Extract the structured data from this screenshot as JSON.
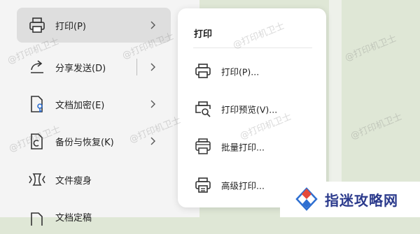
{
  "menu": {
    "items": [
      {
        "label": "打印(P)",
        "icon": "printer-icon",
        "active": true,
        "has_submenu": true
      },
      {
        "label": "分享发送(D)",
        "icon": "share-icon",
        "active": false,
        "has_submenu": true
      },
      {
        "label": "文档加密(E)",
        "icon": "document-key-icon",
        "active": false,
        "has_submenu": true
      },
      {
        "label": "备份与恢复(K)",
        "icon": "backup-icon",
        "active": false,
        "has_submenu": true
      },
      {
        "label": "文件瘦身",
        "icon": "compress-icon",
        "active": false,
        "has_submenu": false
      },
      {
        "label": "文档定稿",
        "icon": "document-final-icon",
        "active": false,
        "has_submenu": false
      }
    ]
  },
  "submenu": {
    "title": "打印",
    "items": [
      {
        "label": "打印(P)...",
        "icon": "printer-icon"
      },
      {
        "label": "打印预览(V)...",
        "icon": "print-preview-icon"
      },
      {
        "label": "批量打印...",
        "icon": "batch-print-icon"
      },
      {
        "label": "高级打印...",
        "icon": "advanced-print-icon"
      }
    ]
  },
  "watermark": "@打印机卫士",
  "brand": {
    "name": "指迷攻略网",
    "logo_colors": [
      "#e5493a",
      "#2e6fd1"
    ]
  },
  "colors": {
    "active_bg": "#dedede",
    "accent_blue": "#2e6fd1",
    "background": "#dfe7d6"
  }
}
